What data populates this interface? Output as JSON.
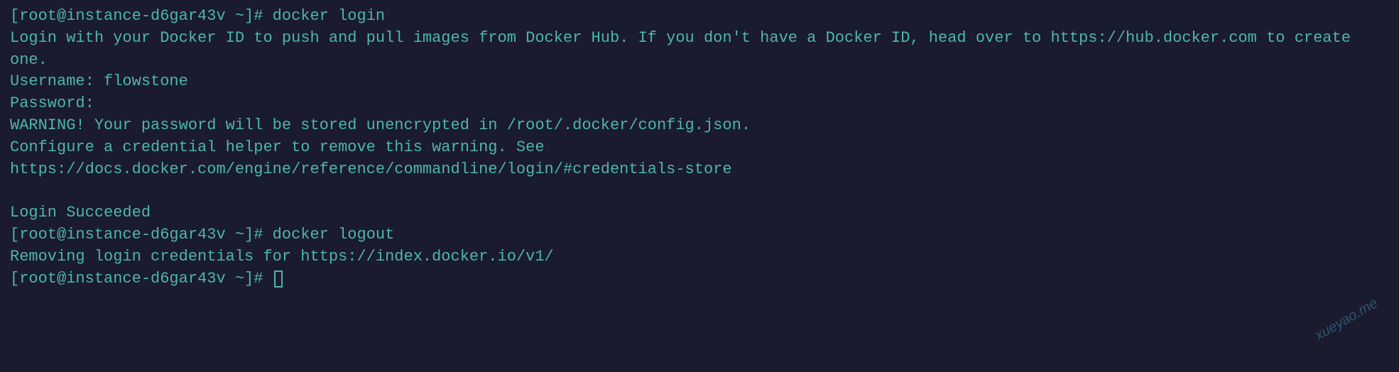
{
  "terminal": {
    "lines": [
      {
        "prompt": "[root@instance-d6gar43v ~]# ",
        "command": "docker login"
      },
      {
        "text": "Login with your Docker ID to push and pull images from Docker Hub. If you don't have a Docker ID, head over to https://hub.docker.com to create one."
      },
      {
        "text": "Username: flowstone"
      },
      {
        "text": "Password:"
      },
      {
        "text": "WARNING! Your password will be stored unencrypted in /root/.docker/config.json."
      },
      {
        "text": "Configure a credential helper to remove this warning. See"
      },
      {
        "text": "https://docs.docker.com/engine/reference/commandline/login/#credentials-store"
      },
      {
        "text": " "
      },
      {
        "text": "Login Succeeded"
      },
      {
        "prompt": "[root@instance-d6gar43v ~]# ",
        "command": "docker logout"
      },
      {
        "text": "Removing login credentials for https://index.docker.io/v1/"
      },
      {
        "prompt": "[root@instance-d6gar43v ~]# ",
        "cursor": true
      }
    ]
  },
  "watermark": "xueyao.me"
}
